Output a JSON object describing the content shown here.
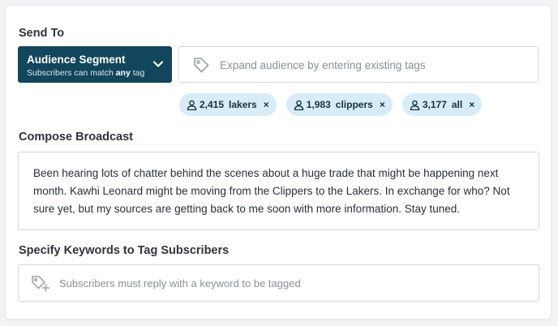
{
  "send_to": {
    "label": "Send To",
    "segment": {
      "title": "Audience Segment",
      "subtitle_prefix": "Subscribers can match ",
      "subtitle_emphasis": "any",
      "subtitle_suffix": " tag",
      "icon": "chevron-down-icon"
    },
    "tag_input": {
      "placeholder": "Expand audience by entering existing tags",
      "icon": "tag-icon"
    },
    "tags": [
      {
        "count": "2,415",
        "name": "lakers",
        "remove": "×"
      },
      {
        "count": "1,983",
        "name": "clippers",
        "remove": "×"
      },
      {
        "count": "3,177",
        "name": "all",
        "remove": "×"
      }
    ]
  },
  "compose": {
    "label": "Compose Broadcast",
    "text": "Been hearing lots of chatter behind the scenes about a huge trade that might be happening next month. Kawhi Leonard might be moving from the Clippers to the Lakers. In exchange for who? Not sure yet, but my sources are getting back to me soon with more information. Stay tuned."
  },
  "keywords": {
    "label": "Specify Keywords to Tag Subscribers",
    "placeholder": "Subscribers must reply with a keyword to be tagged",
    "icon": "add-tag-icon"
  },
  "colors": {
    "segment_bg": "#11465c",
    "chip_bg": "#d8ecf7",
    "border": "#d6d9dc"
  }
}
